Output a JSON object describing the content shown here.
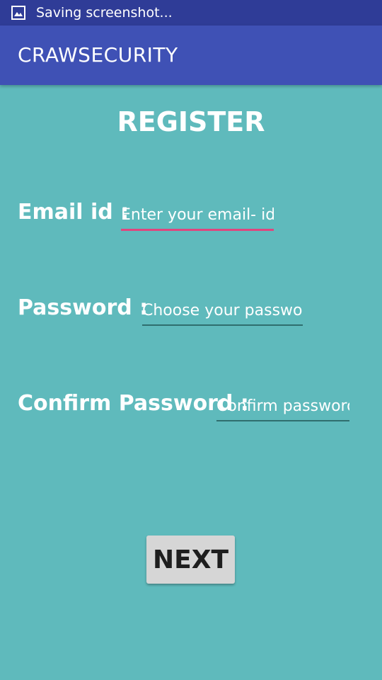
{
  "status_bar": {
    "text": "Saving screenshot...",
    "icon": "image-icon"
  },
  "app_bar": {
    "title": "CRAWSECURITY"
  },
  "form": {
    "heading": "REGISTER",
    "email": {
      "label": "Email id :",
      "placeholder": "Enter your email- id"
    },
    "password": {
      "label": "Password :",
      "placeholder": "Choose your password"
    },
    "confirm_password": {
      "label": "Confirm Password :",
      "placeholder": "Confirm password"
    },
    "next_label": "NEXT"
  },
  "colors": {
    "status_bar": "#2f3c97",
    "app_bar": "#3f51b5",
    "background": "#5fbabc",
    "focus_underline": "#e0467e",
    "button": "#d6d6d6"
  }
}
